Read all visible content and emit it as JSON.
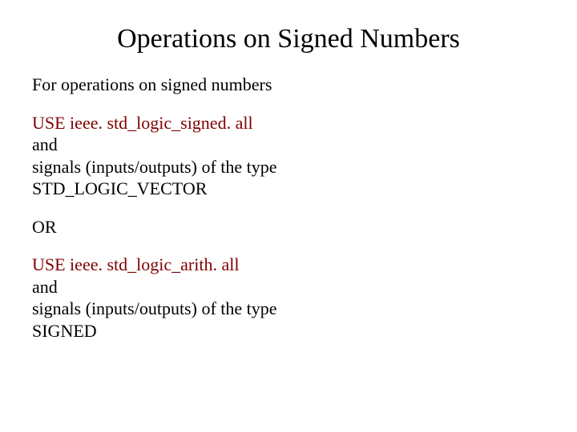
{
  "title": "Operations on Signed Numbers",
  "intro": "For operations on signed numbers",
  "block1": {
    "code": "USE ieee. std_logic_signed. all",
    "line2": "and",
    "line3": "signals (inputs/outputs) of the type",
    "line4": "STD_LOGIC_VECTOR"
  },
  "or_label": "OR",
  "block2": {
    "code": "USE ieee. std_logic_arith. all",
    "line2": "and",
    "line3": "signals (inputs/outputs) of the type",
    "line4": "SIGNED"
  }
}
